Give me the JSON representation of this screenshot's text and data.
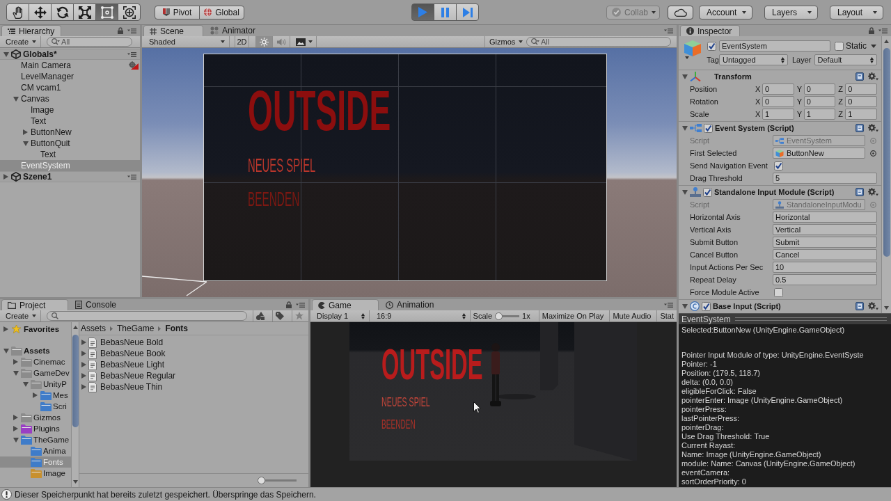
{
  "toolbar": {
    "tools": [
      {
        "kind": "hand",
        "selected": false
      },
      {
        "kind": "move",
        "selected": false
      },
      {
        "kind": "rotate",
        "selected": false
      },
      {
        "kind": "scale",
        "selected": false
      },
      {
        "kind": "rect",
        "selected": true
      },
      {
        "kind": "transform",
        "selected": false
      }
    ],
    "handle_toggles": [
      {
        "kind": "pivot",
        "label": "Pivot"
      },
      {
        "kind": "global",
        "label": "Global"
      }
    ],
    "playback": [
      {
        "kind": "play",
        "on": true
      },
      {
        "kind": "pause",
        "on": false
      },
      {
        "kind": "step",
        "on": false
      }
    ],
    "collab": {
      "label": "Collab",
      "disabled": true
    },
    "menus": [
      {
        "label": "Account"
      },
      {
        "label": "Layers"
      },
      {
        "label": "Layout"
      }
    ]
  },
  "hierarchy": {
    "tab": "Hierarchy",
    "create": "Create",
    "search": {
      "placeholder": "All"
    },
    "scenes": [
      {
        "name": "Globals*",
        "expanded": true,
        "selected": false,
        "children": [
          {
            "name": "Main Camera",
            "selected": false,
            "gizmo_icon": true
          },
          {
            "name": "LevelManager",
            "selected": false
          },
          {
            "name": "CM vcam1",
            "selected": false
          },
          {
            "name": "Canvas",
            "expanded": true,
            "selected": false,
            "children": [
              {
                "name": "Image",
                "selected": false
              },
              {
                "name": "Text",
                "selected": false
              },
              {
                "name": "ButtonNew",
                "expanded": false,
                "selected": false
              },
              {
                "name": "ButtonQuit",
                "expanded": true,
                "selected": false,
                "children": [
                  {
                    "name": "Text",
                    "selected": false
                  }
                ]
              }
            ]
          },
          {
            "name": "EventSystem",
            "selected": true
          }
        ]
      },
      {
        "name": "Szene1",
        "expanded": false,
        "selected": false
      }
    ]
  },
  "scene_view": {
    "tabs": [
      {
        "kind": "scene",
        "label": "Scene",
        "selected": true
      },
      {
        "kind": "animator",
        "label": "Animator",
        "selected": false
      }
    ],
    "shading": "Shaded",
    "mode_2d": {
      "label": "2D",
      "on": false
    },
    "lighting": {
      "on": true
    },
    "audio": {
      "on": false
    },
    "gizmos": "Gizmos",
    "search": {
      "placeholder": "All"
    },
    "canvas_texts": [
      {
        "kind": "title",
        "text": "OUTSIDE",
        "color": "#8c0e0e"
      },
      {
        "kind": "button",
        "text": "NEUES SPIEL",
        "color": "#b9362b"
      },
      {
        "kind": "button",
        "text": "BEENDEN",
        "color": "#7c1812"
      }
    ]
  },
  "inspector": {
    "tab": "Inspector",
    "object": {
      "active": true,
      "name": "EventSystem",
      "static": {
        "label": "Static",
        "checked": false
      },
      "tag": {
        "label": "Tag",
        "value": "Untagged"
      },
      "layer": {
        "label": "Layer",
        "value": "Default"
      }
    },
    "components": [
      {
        "kind": "transform",
        "title": "Transform",
        "expanded": true,
        "properties": [
          {
            "kind": "vector3",
            "label": "Position",
            "fields": [
              {
                "axis": "X",
                "value": "0"
              },
              {
                "axis": "Y",
                "value": "0"
              },
              {
                "axis": "Z",
                "value": "0"
              }
            ]
          },
          {
            "kind": "vector3",
            "label": "Rotation",
            "fields": [
              {
                "axis": "X",
                "value": "0"
              },
              {
                "axis": "Y",
                "value": "0"
              },
              {
                "axis": "Z",
                "value": "0"
              }
            ]
          },
          {
            "kind": "vector3",
            "label": "Scale",
            "fields": [
              {
                "axis": "X",
                "value": "1"
              },
              {
                "axis": "Y",
                "value": "1"
              },
              {
                "axis": "Z",
                "value": "1"
              }
            ]
          }
        ]
      },
      {
        "kind": "event_system",
        "title": "Event System (Script)",
        "expanded": true,
        "enabled": true,
        "properties": [
          {
            "kind": "script",
            "label": "Script",
            "value": "EventSystem",
            "disabled": true
          },
          {
            "kind": "object",
            "label": "First Selected",
            "value": "ButtonNew",
            "disabled": false
          },
          {
            "kind": "toggle",
            "label": "Send Navigation Event",
            "checked": true
          },
          {
            "kind": "text",
            "label": "Drag Threshold",
            "value": "5"
          }
        ]
      },
      {
        "kind": "input_module",
        "title": "Standalone Input Module (Script)",
        "expanded": true,
        "enabled": true,
        "properties": [
          {
            "kind": "script",
            "label": "Script",
            "value": "StandaloneInputModu",
            "disabled": true
          },
          {
            "kind": "text",
            "label": "Horizontal Axis",
            "value": "Horizontal"
          },
          {
            "kind": "text",
            "label": "Vertical Axis",
            "value": "Vertical"
          },
          {
            "kind": "text",
            "label": "Submit Button",
            "value": "Submit"
          },
          {
            "kind": "text",
            "label": "Cancel Button",
            "value": "Cancel"
          },
          {
            "kind": "text",
            "label": "Input Actions Per Sec",
            "value": "10"
          },
          {
            "kind": "text",
            "label": "Repeat Delay",
            "value": "0.5"
          },
          {
            "kind": "toggle",
            "label": "Force Module Active",
            "checked": false
          }
        ]
      },
      {
        "kind": "base_input",
        "title": "Base Input (Script)",
        "expanded": true,
        "enabled": true
      }
    ]
  },
  "project": {
    "tabs": [
      {
        "kind": "project",
        "label": "Project",
        "selected": true
      },
      {
        "kind": "console",
        "label": "Console",
        "selected": false
      }
    ],
    "create": "Create",
    "favorites": {
      "label": "Favorites",
      "expanded": false
    },
    "tree": [
      {
        "name": "Assets",
        "expanded": true,
        "selected": false,
        "color": "#8c8c8c",
        "children": [
          {
            "name": "Cinemac",
            "expanded": false,
            "selected": false,
            "color": "#8c8c8c"
          },
          {
            "name": "GameDev",
            "expanded": true,
            "selected": false,
            "color": "#8c8c8c",
            "children": [
              {
                "name": "UnityP",
                "expanded": true,
                "selected": false,
                "color": "#8c8c8c",
                "children": [
                  {
                    "name": "Mes",
                    "expanded": false,
                    "selected": false,
                    "color": "#3f7cc9"
                  },
                  {
                    "name": "Scri",
                    "selected": false,
                    "color": "#3f7cc9"
                  }
                ]
              }
            ]
          },
          {
            "name": "Gizmos",
            "expanded": false,
            "selected": false,
            "color": "#8c8c8c"
          },
          {
            "name": "Plugins",
            "expanded": false,
            "selected": false,
            "color": "#9a3fc4"
          },
          {
            "name": "TheGame",
            "expanded": true,
            "selected": false,
            "color": "#3f7cc9",
            "children": [
              {
                "name": "Anima",
                "selected": false,
                "color": "#3f7cc9"
              },
              {
                "name": "Fonts",
                "selected": true,
                "color": "#3f7cc9"
              },
              {
                "name": "Image",
                "selected": false,
                "color": "#c8902e"
              }
            ]
          }
        ]
      }
    ],
    "breadcrumb": [
      "Assets",
      "TheGame",
      "Fonts"
    ],
    "files": [
      {
        "name": "BebasNeue Bold",
        "expanded": false
      },
      {
        "name": "BebasNeue Book",
        "expanded": false
      },
      {
        "name": "BebasNeue Light",
        "expanded": false
      },
      {
        "name": "BebasNeue Regular",
        "expanded": false
      },
      {
        "name": "BebasNeue Thin",
        "expanded": false
      }
    ],
    "icon_size": {
      "level": 0
    }
  },
  "game_view": {
    "tabs": [
      {
        "kind": "game",
        "label": "Game",
        "selected": true
      },
      {
        "kind": "animation",
        "label": "Animation",
        "selected": false
      }
    ],
    "display": "Display 1",
    "aspect": "16:9",
    "scale_label": "Scale",
    "scale": {
      "level": 0
    },
    "scale_value": "1x",
    "buttons": [
      "Maximize On Play",
      "Mute Audio",
      "Stat"
    ],
    "canvas_texts": [
      {
        "kind": "title",
        "text": "OUTSIDE",
        "color": "#b81c1c"
      },
      {
        "kind": "button",
        "text": "NEUES SPIEL",
        "color": "#c4463a"
      },
      {
        "kind": "button",
        "text": "BEENDEN",
        "color": "#aa3128"
      }
    ]
  },
  "event_system_debug": {
    "title": "EventSystem",
    "sections": [
      [
        "Selected:ButtonNew (UnityEngine.GameObject)"
      ],
      [
        "Pointer Input Module of type: UnityEngine.EventSyste",
        "Pointer: -1",
        "Position: (179.5, 118.7)",
        "delta: (0.0, 0.0)",
        "eligibleForClick: False",
        "pointerEnter: Image (UnityEngine.GameObject)",
        "pointerPress:",
        "lastPointerPress:",
        "pointerDrag:",
        "Use Drag Threshold: True",
        "Current Rayast:",
        "Name: Image (UnityEngine.GameObject)",
        "module: Name: Canvas (UnityEngine.GameObject)",
        "eventCamera:",
        "sortOrderPriority: 0"
      ]
    ]
  },
  "status_bar": {
    "message": "Dieser Speicherpunkt hat bereits zuletzt gespeichert. Überspringe das Speichern."
  }
}
